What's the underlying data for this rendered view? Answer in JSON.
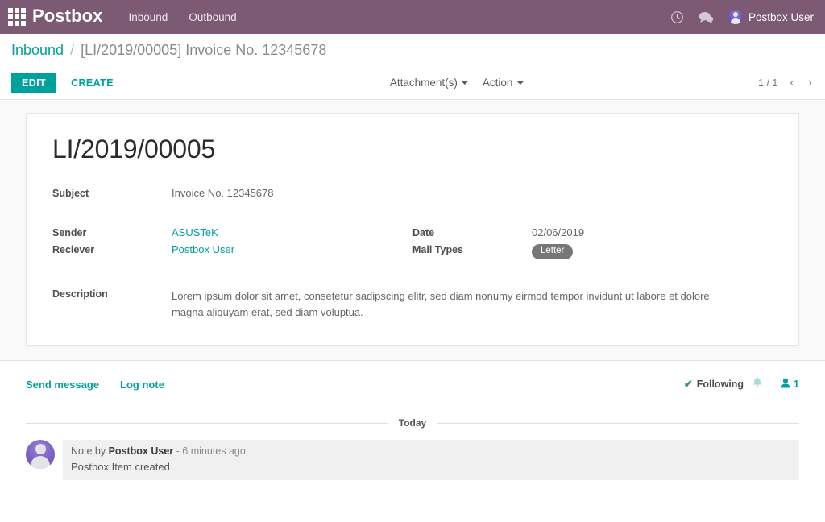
{
  "navbar": {
    "apps_icon": "apps-grid-icon",
    "brand": "Postbox",
    "menu": [
      {
        "label": "Inbound"
      },
      {
        "label": "Outbound"
      }
    ],
    "icons": [
      {
        "name": "clock-icon"
      },
      {
        "name": "chat-bubble-icon"
      }
    ],
    "user": {
      "name": "Postbox User",
      "avatar": "user-avatar"
    },
    "bg_color": "#7c5a74"
  },
  "breadcrumb": {
    "root": "Inbound",
    "separator": "/",
    "current": "[LI/2019/00005] Invoice No. 12345678"
  },
  "control_panel": {
    "edit_label": "EDIT",
    "create_label": "CREATE",
    "attachments_label": "Attachment(s)",
    "action_label": "Action",
    "pager": {
      "count": "1 / 1",
      "prev_icon": "chevron-left-icon",
      "next_icon": "chevron-right-icon"
    },
    "accent_color": "#00a09d"
  },
  "form": {
    "title": "LI/2019/00005",
    "fields": {
      "subject": {
        "label": "Subject",
        "value": "Invoice No. 12345678"
      },
      "sender": {
        "label": "Sender",
        "value": "ASUSTeK"
      },
      "reciever": {
        "label": "Reciever",
        "value": "Postbox User"
      },
      "date": {
        "label": "Date",
        "value": "02/06/2019"
      },
      "mail_types": {
        "label": "Mail Types",
        "value": "Letter",
        "tag_color": "#777777"
      },
      "description": {
        "label": "Description",
        "value": "Lorem ipsum dolor sit amet, consetetur sadipscing elitr, sed diam nonumy eirmod tempor invidunt ut labore et dolore magna aliquyam erat, sed diam voluptua."
      }
    }
  },
  "chatter": {
    "send_message_label": "Send message",
    "log_note_label": "Log note",
    "following_label": "Following",
    "check_glyph": "✔",
    "bell_icon": "bell-icon",
    "follower_count": "1",
    "date_separator": "Today",
    "messages": [
      {
        "prefix": "Note by",
        "author": "Postbox User",
        "timestamp": "- 6 minutes ago",
        "body": "Postbox Item created"
      }
    ]
  }
}
